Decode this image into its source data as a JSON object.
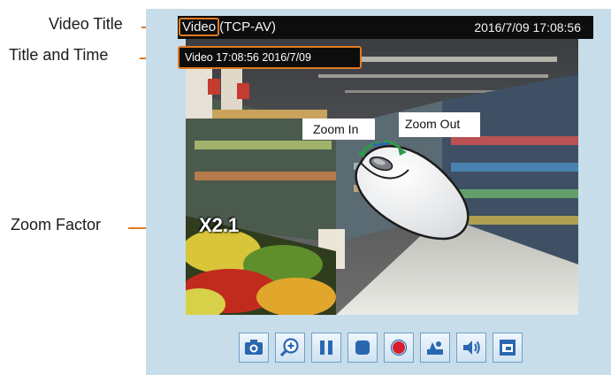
{
  "annotations": {
    "video_title": "Video Title",
    "title_and_time": "Title and Time",
    "zoom_factor": "Zoom Factor"
  },
  "titlebar": {
    "title_prefix": "Video",
    "title_suffix": "(TCP-AV)",
    "datetime": "2016/7/09  17:08:56"
  },
  "overlay": {
    "text": "Video 17:08:56  2016/7/09"
  },
  "zoom": {
    "factor": "X2.1",
    "zoom_in_label": "Zoom In",
    "zoom_out_label": "Zoom Out"
  },
  "toolbar": {
    "buttons": [
      {
        "icon": "camera-icon"
      },
      {
        "icon": "digital-zoom-icon"
      },
      {
        "icon": "pause-icon"
      },
      {
        "icon": "stop-icon"
      },
      {
        "icon": "record-icon"
      },
      {
        "icon": "volume-mute-icon"
      },
      {
        "icon": "speaker-icon"
      },
      {
        "icon": "fullscreen-icon"
      }
    ]
  },
  "colors": {
    "accent": "#e07a20",
    "panel": "#c7dde9",
    "titlebar": "#0d0d0d",
    "button_icon": "#2a67b1",
    "record": "#d81e2a"
  }
}
